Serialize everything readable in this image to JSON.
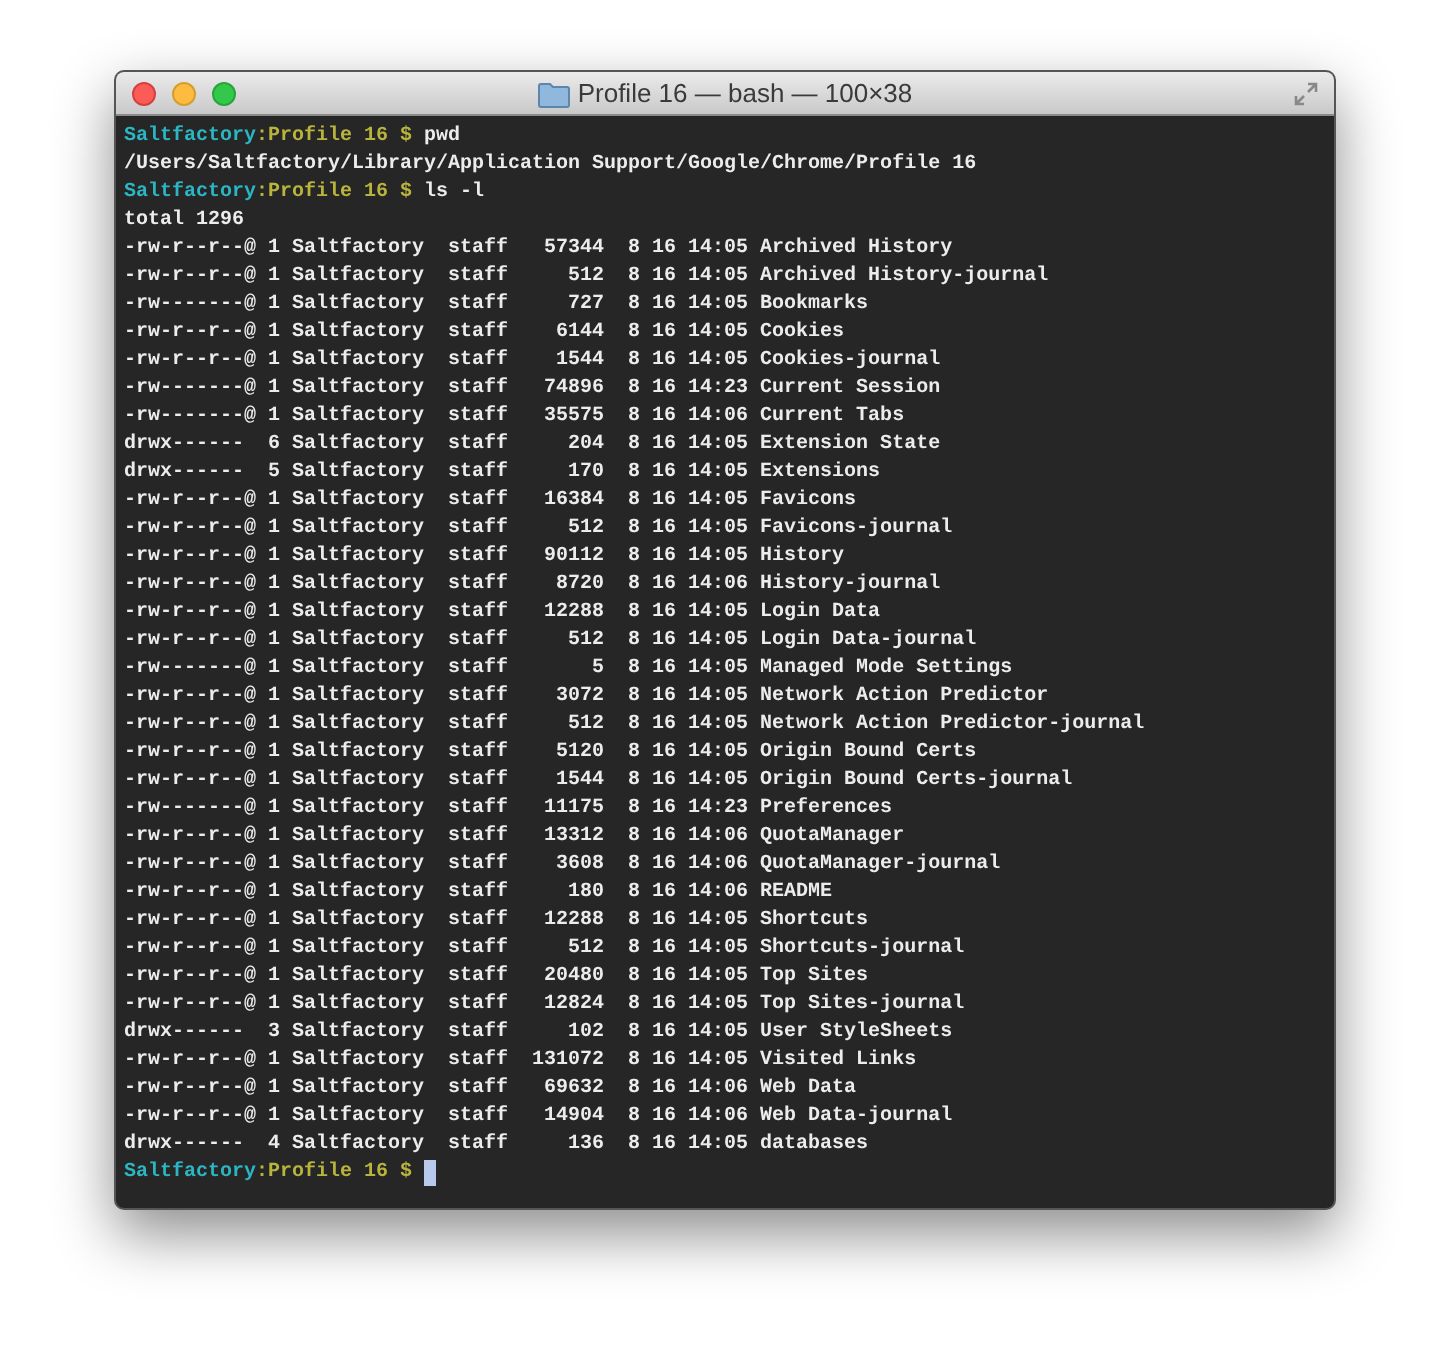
{
  "window": {
    "title": "Profile 16 — bash — 100×38"
  },
  "terminal": {
    "lines": [
      {
        "kind": "prompt",
        "user": "Saltfactory",
        "separator": ":",
        "path": "Profile 16",
        "symbol": "$",
        "command": "pwd",
        "cursor": false
      },
      {
        "kind": "output",
        "text": "/Users/Saltfactory/Library/Application Support/Google/Chrome/Profile 16"
      },
      {
        "kind": "prompt",
        "user": "Saltfactory",
        "separator": ":",
        "path": "Profile 16",
        "symbol": "$",
        "command": "ls -l",
        "cursor": false
      },
      {
        "kind": "output",
        "text": "total 1296"
      },
      {
        "kind": "output",
        "text": "-rw-r--r--@ 1 Saltfactory  staff   57344  8 16 14:05 Archived History"
      },
      {
        "kind": "output",
        "text": "-rw-r--r--@ 1 Saltfactory  staff     512  8 16 14:05 Archived History-journal"
      },
      {
        "kind": "output",
        "text": "-rw-------@ 1 Saltfactory  staff     727  8 16 14:05 Bookmarks"
      },
      {
        "kind": "output",
        "text": "-rw-r--r--@ 1 Saltfactory  staff    6144  8 16 14:05 Cookies"
      },
      {
        "kind": "output",
        "text": "-rw-r--r--@ 1 Saltfactory  staff    1544  8 16 14:05 Cookies-journal"
      },
      {
        "kind": "output",
        "text": "-rw-------@ 1 Saltfactory  staff   74896  8 16 14:23 Current Session"
      },
      {
        "kind": "output",
        "text": "-rw-------@ 1 Saltfactory  staff   35575  8 16 14:06 Current Tabs"
      },
      {
        "kind": "output",
        "text": "drwx------  6 Saltfactory  staff     204  8 16 14:05 Extension State"
      },
      {
        "kind": "output",
        "text": "drwx------  5 Saltfactory  staff     170  8 16 14:05 Extensions"
      },
      {
        "kind": "output",
        "text": "-rw-r--r--@ 1 Saltfactory  staff   16384  8 16 14:05 Favicons"
      },
      {
        "kind": "output",
        "text": "-rw-r--r--@ 1 Saltfactory  staff     512  8 16 14:05 Favicons-journal"
      },
      {
        "kind": "output",
        "text": "-rw-r--r--@ 1 Saltfactory  staff   90112  8 16 14:05 History"
      },
      {
        "kind": "output",
        "text": "-rw-r--r--@ 1 Saltfactory  staff    8720  8 16 14:06 History-journal"
      },
      {
        "kind": "output",
        "text": "-rw-r--r--@ 1 Saltfactory  staff   12288  8 16 14:05 Login Data"
      },
      {
        "kind": "output",
        "text": "-rw-r--r--@ 1 Saltfactory  staff     512  8 16 14:05 Login Data-journal"
      },
      {
        "kind": "output",
        "text": "-rw-------@ 1 Saltfactory  staff       5  8 16 14:05 Managed Mode Settings"
      },
      {
        "kind": "output",
        "text": "-rw-r--r--@ 1 Saltfactory  staff    3072  8 16 14:05 Network Action Predictor"
      },
      {
        "kind": "output",
        "text": "-rw-r--r--@ 1 Saltfactory  staff     512  8 16 14:05 Network Action Predictor-journal"
      },
      {
        "kind": "output",
        "text": "-rw-r--r--@ 1 Saltfactory  staff    5120  8 16 14:05 Origin Bound Certs"
      },
      {
        "kind": "output",
        "text": "-rw-r--r--@ 1 Saltfactory  staff    1544  8 16 14:05 Origin Bound Certs-journal"
      },
      {
        "kind": "output",
        "text": "-rw-------@ 1 Saltfactory  staff   11175  8 16 14:23 Preferences"
      },
      {
        "kind": "output",
        "text": "-rw-r--r--@ 1 Saltfactory  staff   13312  8 16 14:06 QuotaManager"
      },
      {
        "kind": "output",
        "text": "-rw-r--r--@ 1 Saltfactory  staff    3608  8 16 14:06 QuotaManager-journal"
      },
      {
        "kind": "output",
        "text": "-rw-r--r--@ 1 Saltfactory  staff     180  8 16 14:06 README"
      },
      {
        "kind": "output",
        "text": "-rw-r--r--@ 1 Saltfactory  staff   12288  8 16 14:05 Shortcuts"
      },
      {
        "kind": "output",
        "text": "-rw-r--r--@ 1 Saltfactory  staff     512  8 16 14:05 Shortcuts-journal"
      },
      {
        "kind": "output",
        "text": "-rw-r--r--@ 1 Saltfactory  staff   20480  8 16 14:05 Top Sites"
      },
      {
        "kind": "output",
        "text": "-rw-r--r--@ 1 Saltfactory  staff   12824  8 16 14:05 Top Sites-journal"
      },
      {
        "kind": "output",
        "text": "drwx------  3 Saltfactory  staff     102  8 16 14:05 User StyleSheets"
      },
      {
        "kind": "output",
        "text": "-rw-r--r--@ 1 Saltfactory  staff  131072  8 16 14:05 Visited Links"
      },
      {
        "kind": "output",
        "text": "-rw-r--r--@ 1 Saltfactory  staff   69632  8 16 14:06 Web Data"
      },
      {
        "kind": "output",
        "text": "-rw-r--r--@ 1 Saltfactory  staff   14904  8 16 14:06 Web Data-journal"
      },
      {
        "kind": "output",
        "text": "drwx------  4 Saltfactory  staff     136  8 16 14:05 databases"
      },
      {
        "kind": "prompt",
        "user": "Saltfactory",
        "separator": ":",
        "path": "Profile 16",
        "symbol": "$",
        "cursor": true
      }
    ]
  }
}
